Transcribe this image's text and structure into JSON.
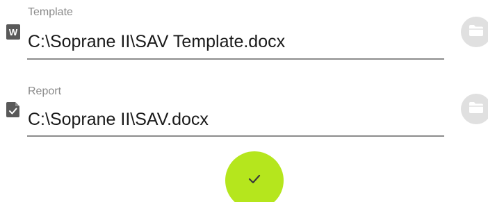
{
  "fields": {
    "template": {
      "label": "Template",
      "value": "C:\\Soprane II\\SAV Template.docx",
      "icon": "word-document-icon",
      "browse_icon": "folder-icon"
    },
    "report": {
      "label": "Report",
      "value": "C:\\Soprane II\\SAV.docx",
      "icon": "report-document-icon",
      "browse_icon": "folder-icon"
    }
  },
  "confirm": {
    "icon": "checkmark-icon"
  },
  "colors": {
    "accent": "#b5e61d",
    "browse_button": "#e0e0e0",
    "underline": "#8c8c8c",
    "label": "#8a8a8a",
    "text": "#1a1a1a"
  }
}
